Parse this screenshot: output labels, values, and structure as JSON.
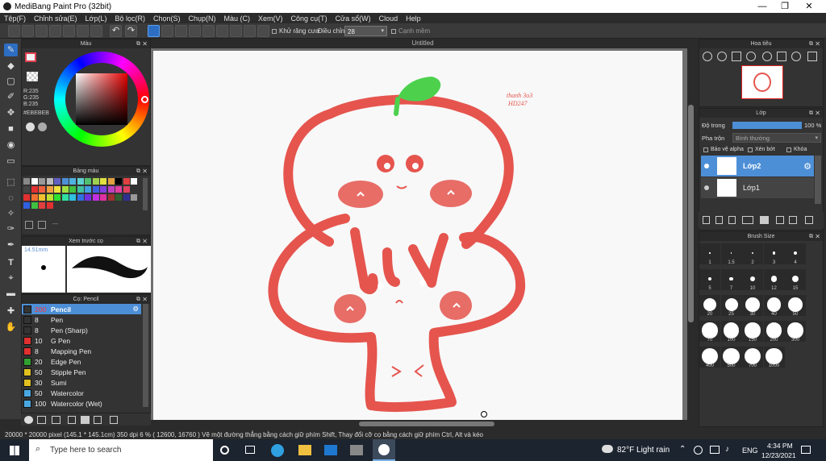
{
  "window": {
    "title": "MediBang Paint Pro (32bit)",
    "min": "—",
    "max": "❐",
    "close": "✕"
  },
  "menu": [
    "Tệp(F)",
    "Chỉnh sửa(E)",
    "Lớp(L)",
    "Bộ lọc(R)",
    "Chọn(S)",
    "Chụp(N)",
    "Màu (C)",
    "Xem(V)",
    "Công cụ(T)",
    "Cửa sổ(W)",
    "Cloud",
    "Help"
  ],
  "toolbar": {
    "antialias": "Khử răng cưa",
    "adjust_label": "Điều chỉnh",
    "adjust_value": "28",
    "snap": "Cạnh mềm"
  },
  "color_panel": {
    "title": "Màu",
    "r": "R:235",
    "g": "G:235",
    "b": "B:235",
    "hex": "#EBEBEB",
    "primary": "#f2f2f2",
    "secondary": "#2b3fd1"
  },
  "palette_panel": {
    "title": "Bảng màu",
    "more": "---"
  },
  "preview_panel": {
    "title": "Xem trước cọ",
    "size": "14.51mm"
  },
  "brush_panel": {
    "title": "Cọ: Pencil",
    "items": [
      {
        "size": "200",
        "name": "Pencil",
        "color": "#333333"
      },
      {
        "size": "8",
        "name": "Pen",
        "color": "#333333"
      },
      {
        "size": "8",
        "name": "Pen (Sharp)",
        "color": "#333333"
      },
      {
        "size": "10",
        "name": "G Pen",
        "color": "#e03030"
      },
      {
        "size": "8",
        "name": "Mapping Pen",
        "color": "#e03030"
      },
      {
        "size": "20",
        "name": "Edge Pen",
        "color": "#30a030"
      },
      {
        "size": "50",
        "name": "Stipple Pen",
        "color": "#e0c020"
      },
      {
        "size": "30",
        "name": "Sumi",
        "color": "#e0c020"
      },
      {
        "size": "50",
        "name": "Watercolor",
        "color": "#4aa8e0"
      },
      {
        "size": "100",
        "name": "Watercolor (Wet)",
        "color": "#4aa8e0"
      }
    ]
  },
  "canvas": {
    "title": "Untitled",
    "signature_line1": "thanh 3o3",
    "signature_line2": "HD247"
  },
  "navigator": {
    "title": "Hoa tiêu"
  },
  "layer_panel": {
    "title": "Lớp",
    "opacity_label": "Độ trong",
    "opacity_value": "100 %",
    "blend_label": "Pha trộn",
    "blend_value": "Bình thường",
    "protect_alpha": "Bảo vệ alpha",
    "clip": "Xén bớt",
    "lock": "Khóa",
    "layers": [
      "Lớp2",
      "Lớp1"
    ]
  },
  "brush_size_panel": {
    "title": "Brush Size",
    "sizes": [
      "1",
      "1.5",
      "2",
      "3",
      "4",
      "5",
      "7",
      "10",
      "12",
      "15",
      "20",
      "25",
      "30",
      "40",
      "50",
      "70",
      "100",
      "150",
      "200",
      "300",
      "400",
      "500",
      "700",
      "1000"
    ]
  },
  "status": {
    "text": "20000 * 20000 pixel   (145.1 * 145.1cm)   350 dpi   6 %   ( 12600, 16760 )   Vẽ một đường thẳng bằng cách giữ phím Shift, Thay đổi cỡ cọ bằng cách giữ phím Ctrl, Alt và kéo"
  },
  "taskbar": {
    "search": "Type here to search",
    "weather": "82°F  Light rain",
    "lang": "ENG",
    "time": "4:34 PM",
    "date": "12/23/2021"
  }
}
